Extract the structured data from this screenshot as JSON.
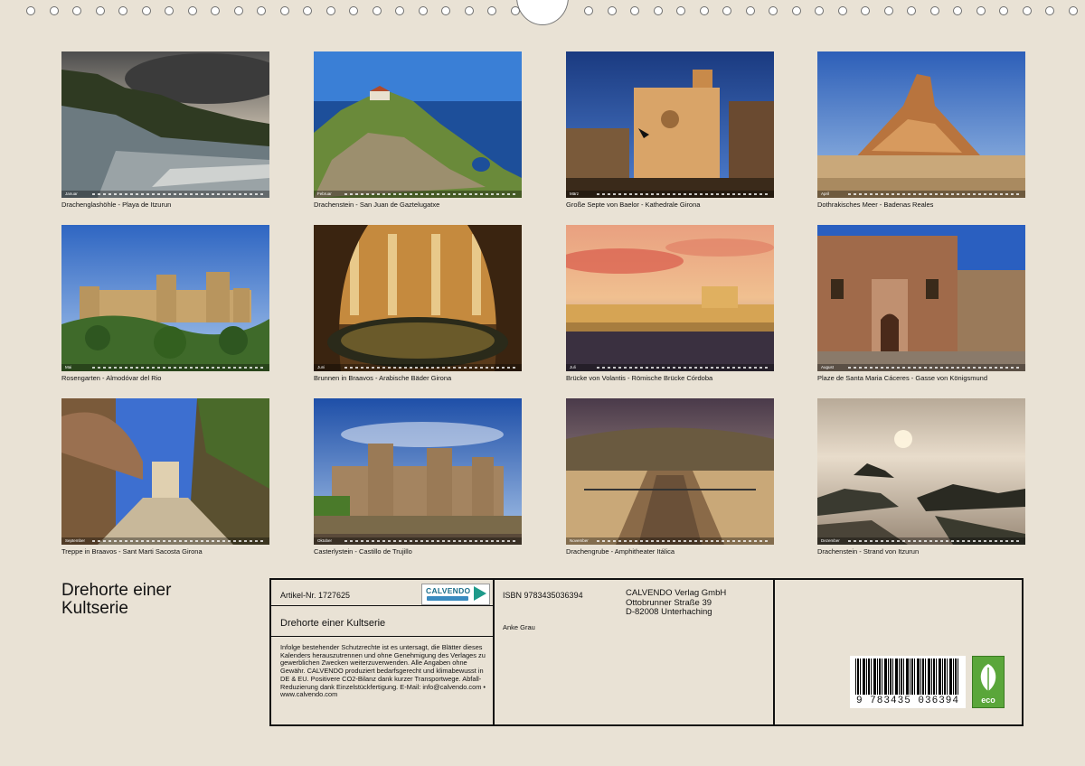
{
  "tiles": [
    {
      "caption": "Drachenglashöhle - Playa de Itzurun",
      "month": "Januar"
    },
    {
      "caption": "Drachenstein - San Juan de Gaztelugatxe",
      "month": "Februar"
    },
    {
      "caption": "Große Septe von Baelor - Kathedrale Girona",
      "month": "März"
    },
    {
      "caption": "Dothrakisches Meer - Badenas Reales",
      "month": "April"
    },
    {
      "caption": "Rosengarten - Almodóvar del Rio",
      "month": "Mai"
    },
    {
      "caption": "Brunnen in Braavos - Arabische Bäder Girona",
      "month": "Juni"
    },
    {
      "caption": "Brücke von Volantis - Römische Brücke Córdoba",
      "month": "Juli"
    },
    {
      "caption": "Plaze de Santa Maria Cáceres - Gasse von Königsmund",
      "month": "August"
    },
    {
      "caption": "Treppe in Braavos - Sant Marti Sacosta Girona",
      "month": "September"
    },
    {
      "caption": "Casterlystein - Castillo de Trujillo",
      "month": "Oktober"
    },
    {
      "caption": "Drachengrube - Amphitheater Itálica",
      "month": "November"
    },
    {
      "caption": "Drachenstein - Strand von Itzurun",
      "month": "Dezember"
    }
  ],
  "cover": {
    "title": "Drehorte einer Kultserie"
  },
  "info": {
    "artikel": "Artikel-Nr. 1727625",
    "calendar_title": "Drehorte einer Kultserie",
    "legal": "Infolge bestehender Schutzrechte ist es untersagt, die Blätter dieses Kalenders herauszutrennen und ohne Genehmigung des Verlages zu gewerblichen Zwecken weiterzuverwenden. Alle Angaben ohne Gewähr. CALVENDO produziert bedarfsgerecht und klimabewusst in DE & EU. Positivere CO2-Bilanz dank kurzer Transportwege. Abfall-Reduzierung dank Einzelstückfertigung. E-Mail: info@calvendo.com • www.calvendo.com",
    "isbn": "ISBN 9783435036394",
    "author": "Anke Grau",
    "publisher_name": "CALVENDO Verlag GmbH",
    "publisher_street": "Ottobrunner Straße 39",
    "publisher_city": "D-82008 Unterhaching",
    "logo_text": "CALVENDO",
    "barcode_number": "9 783435 036394",
    "eco_label": "eco"
  }
}
